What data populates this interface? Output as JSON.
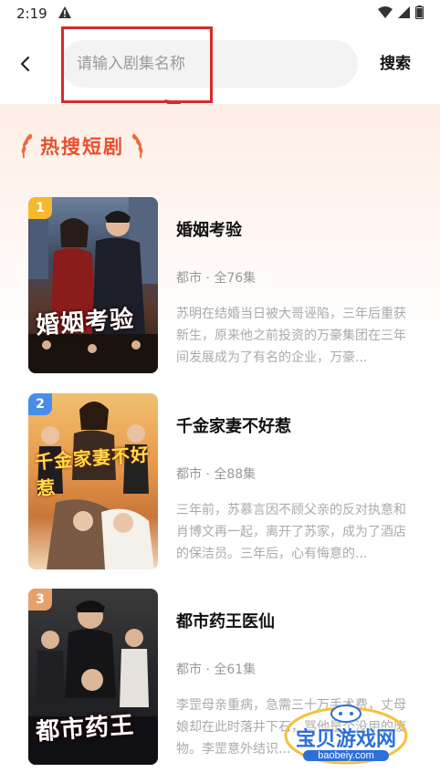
{
  "status": {
    "time": "2:19"
  },
  "search": {
    "placeholder": "请输入剧集名称",
    "button_label": "搜索"
  },
  "section": {
    "title": "热搜短剧"
  },
  "dramas": [
    {
      "rank": "1",
      "rank_color": "#f5b82e",
      "title": "婚姻考验",
      "poster_text": "婚姻考验",
      "meta": "都市 · 全76集",
      "desc": "苏明在结婚当日被大哥诬陷，三年后重获新生，原来他之前投资的万豪集团在三年间发展成为了有名的企业，万豪..."
    },
    {
      "rank": "2",
      "rank_color": "#4a8de8",
      "title": "千金家妻不好惹",
      "poster_text": "千金家妻不好惹",
      "meta": "都市 · 全88集",
      "desc": "三年前，苏慕言因不顾父亲的反对执意和肖博文再一起，离开了苏家，成为了酒店的保洁员。三年后，心有悔意的..."
    },
    {
      "rank": "3",
      "rank_color": "#e8a06a",
      "title": "都市药王医仙",
      "poster_text": "都市药王",
      "meta": "都市 · 全61集",
      "desc": "李罡母亲重病，急需三十万手术费，丈母娘却在此时落井下石，骂他是个没用的废物。李罡意外结识..."
    }
  ],
  "watermark": {
    "text": "宝贝游戏网",
    "url": "baobeiy.com"
  }
}
